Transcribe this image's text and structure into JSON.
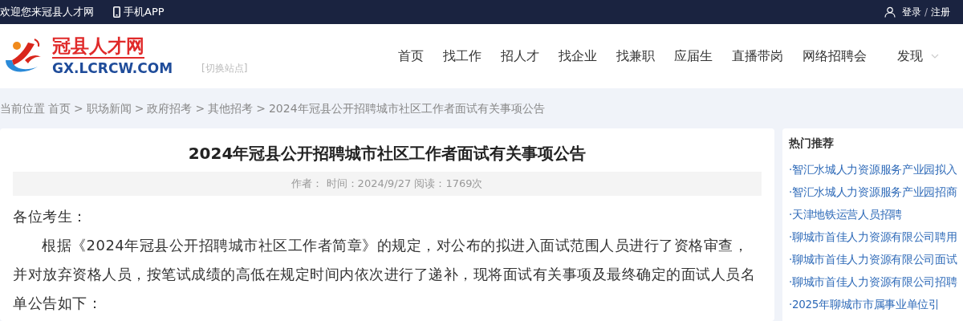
{
  "top_bar": {
    "welcome": "欢迎您来冠县人才网",
    "app_link": "手机APP",
    "login": "登录",
    "separator": "/",
    "register": "注册"
  },
  "header": {
    "logo_title": "冠县人才网",
    "logo_domain": "GX.LCRCW.COM",
    "switch_site": "[切换站点]",
    "nav": [
      {
        "label": "首页",
        "dropdown": false
      },
      {
        "label": "找工作",
        "dropdown": false
      },
      {
        "label": "招人才",
        "dropdown": false
      },
      {
        "label": "找企业",
        "dropdown": false
      },
      {
        "label": "找兼职",
        "dropdown": false
      },
      {
        "label": "应届生",
        "dropdown": false
      },
      {
        "label": "直播带岗",
        "dropdown": false
      },
      {
        "label": "网络招聘会",
        "dropdown": false
      },
      {
        "label": "发现",
        "dropdown": true
      }
    ]
  },
  "breadcrumb": {
    "prefix": "当前位置",
    "separator": ">",
    "items": [
      "首页",
      "职场新闻",
      "政府招考",
      "其他招考",
      "2024年冠县公开招聘城市社区工作者面试有关事项公告"
    ]
  },
  "article": {
    "title": "2024年冠县公开招聘城市社区工作者面试有关事项公告",
    "meta": "作者：  时间：2024/9/27 阅读：1769次",
    "greeting": "各位考生：",
    "paragraph": "根据《2024年冠县公开招聘城市社区工作者简章》的规定，对公布的拟进入面试范围人员进行了资格审查，并对放弃资格人员，按笔试成绩的高低在规定时间内依次进行了递补，现将面试有关事项及最终确定的面试人员名单公告如下："
  },
  "sidebar": {
    "title": "热门推荐",
    "items": [
      "·智汇水城人力资源服务产业园拟入",
      "·智汇水城人力资源服务产业园招商",
      "·天津地铁运营人员招聘",
      "·聊城市首佳人力资源有限公司聘用",
      "·聊城市首佳人力资源有限公司面试",
      "·聊城市首佳人力资源有限公司招聘",
      "·2025年聊城市市属事业单位引"
    ]
  }
}
